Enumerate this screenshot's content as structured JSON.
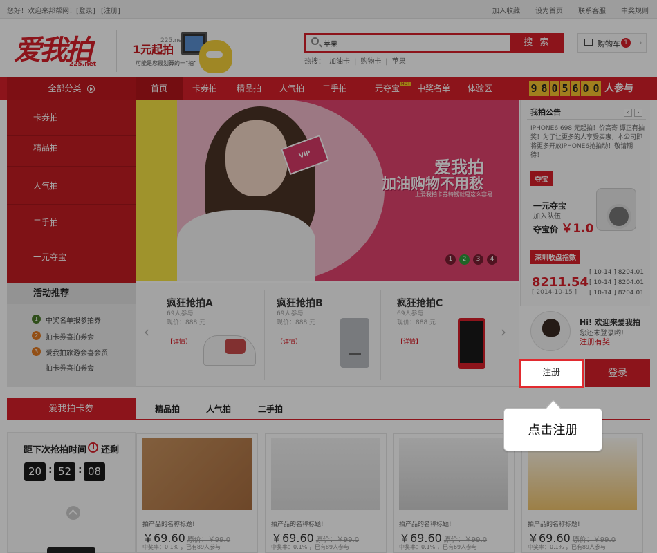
{
  "topbar": {
    "welcome": "您好！欢迎来邦帮网！",
    "login": "[登录]",
    "register": "[注册]",
    "links": [
      "加入收藏",
      "设为首页",
      "联系客服",
      "中奖规则"
    ]
  },
  "header": {
    "logo_text": "爱我拍",
    "logo_sub": "225.net",
    "slogan_url": "225.net",
    "slogan": "1元起拍",
    "slogan_small": "可能是您最划算的一“拍”",
    "search_value": "苹果",
    "search_button": "搜 索",
    "hot_label": "热搜：",
    "hot_words": [
      "加油卡",
      "|",
      "购物卡",
      "|",
      "苹果"
    ],
    "cart_label": "购物车",
    "cart_count": "1",
    "cart_chevron": "›"
  },
  "nav": {
    "all_categories": "全部分类",
    "items": [
      "首页",
      "卡券拍",
      "精品拍",
      "人气拍",
      "二手拍",
      "一元夺宝",
      "中奖名单",
      "体验区"
    ],
    "hot_badge": "HOT",
    "counter_digits": [
      "9",
      "8",
      "0",
      "5",
      "6",
      "0",
      "0"
    ],
    "counter_suffix": "人参与"
  },
  "sidebar": {
    "items": [
      "卡券拍",
      "精品拍",
      "人气拍",
      "二手拍",
      "一元夺宝"
    ],
    "activity_title": "活动推荐",
    "activities": [
      {
        "num": "1",
        "text": "中奖名单报参拍券",
        "color": "#4a7a2a"
      },
      {
        "num": "2",
        "text": "拍卡券喜拍券会",
        "color": "#e07a22"
      },
      {
        "num": "3",
        "text": "爱我拍旅游会喜会贸",
        "color": "#e07a22"
      },
      {
        "num": "",
        "text": "拍卡券喜拍券会",
        "color": ""
      }
    ]
  },
  "banner": {
    "card_text": "VIP",
    "title": "爱我拍",
    "subtitle": "加油购物不用愁",
    "note": "上爱我拍卡券特钱就是这么容易",
    "dots": [
      "1",
      "2",
      "3",
      "4"
    ],
    "active_dot": 2
  },
  "products": [
    {
      "name": "疯狂抢拍A",
      "participants": "69人参与",
      "price": "现价：888 元",
      "detail": "【详情】"
    },
    {
      "name": "疯狂抢拍B",
      "participants": "69人参与",
      "price": "现价：888 元",
      "detail": "【详情】"
    },
    {
      "name": "疯狂抢拍C",
      "participants": "69人参与",
      "price": "现价：888 元",
      "detail": "【详情】"
    }
  ],
  "arrows": {
    "prev": "‹",
    "next": "›"
  },
  "notice": {
    "title": "我拍公告",
    "prev": "‹",
    "next": "›",
    "body": "IPHONE6 698 元起拍！价高寄 谭正有抽奖！为了让更多的人享受买惠，本公司即将更多开放IPHONE6抢拍动！敬请期待！"
  },
  "duobao": {
    "tag": "夺宝",
    "line1": "一元夺宝",
    "line2": "加入队伍",
    "price_label": "夺宝价",
    "price": "￥1.0"
  },
  "index": {
    "tag": "深圳收盘指数",
    "value": "8211.54",
    "date": "[ 2014-10-15 ]",
    "list": [
      "[ 10-14 ]  8204.01",
      "[ 10-14 ]  8204.01",
      "[ 10-14 ]  8204.01"
    ]
  },
  "welcome": {
    "hi": "Hi! 欢迎来爱我拍",
    "line2": "您还未登录哟!",
    "line3": "注册有奖",
    "register_button": "注册",
    "login_button": "登录"
  },
  "tooltip": {
    "text": "点击注册"
  },
  "section": {
    "title": "爱我拍卡券",
    "tabs": [
      "精品拍",
      "人气拍",
      "二手拍"
    ]
  },
  "timer": {
    "label": "距下次抢拍时间",
    "label2": "还剩",
    "hours": "20",
    "minutes": "52",
    "seconds": "08",
    "sep": ":"
  },
  "cards": [
    {
      "name": "拍产品的名称标题!",
      "price": "￥69.60",
      "old": "原价：￥99.0",
      "meta": "中奖率：0.1% ，已有89人参与"
    },
    {
      "name": "拍产品的名称标题!",
      "price": "￥69.60",
      "old": "原价：￥99.0",
      "meta": "中奖率：0.1% ，已有89人参与"
    },
    {
      "name": "拍产品的名称标题!",
      "price": "￥69.60",
      "old": "原价：￥99.0",
      "meta": "中奖率：0.1% ，已有69人参与"
    },
    {
      "name": "拍产品的名称标题!",
      "price": "￥69.60",
      "old": "原价：￥99.0",
      "meta": "中奖率：0.1% ，已有89人参与"
    }
  ],
  "colors": {
    "brand": "#d8202a",
    "counter": "#f6c32f",
    "overlay": "rgba(0,0,0,0.35)"
  }
}
